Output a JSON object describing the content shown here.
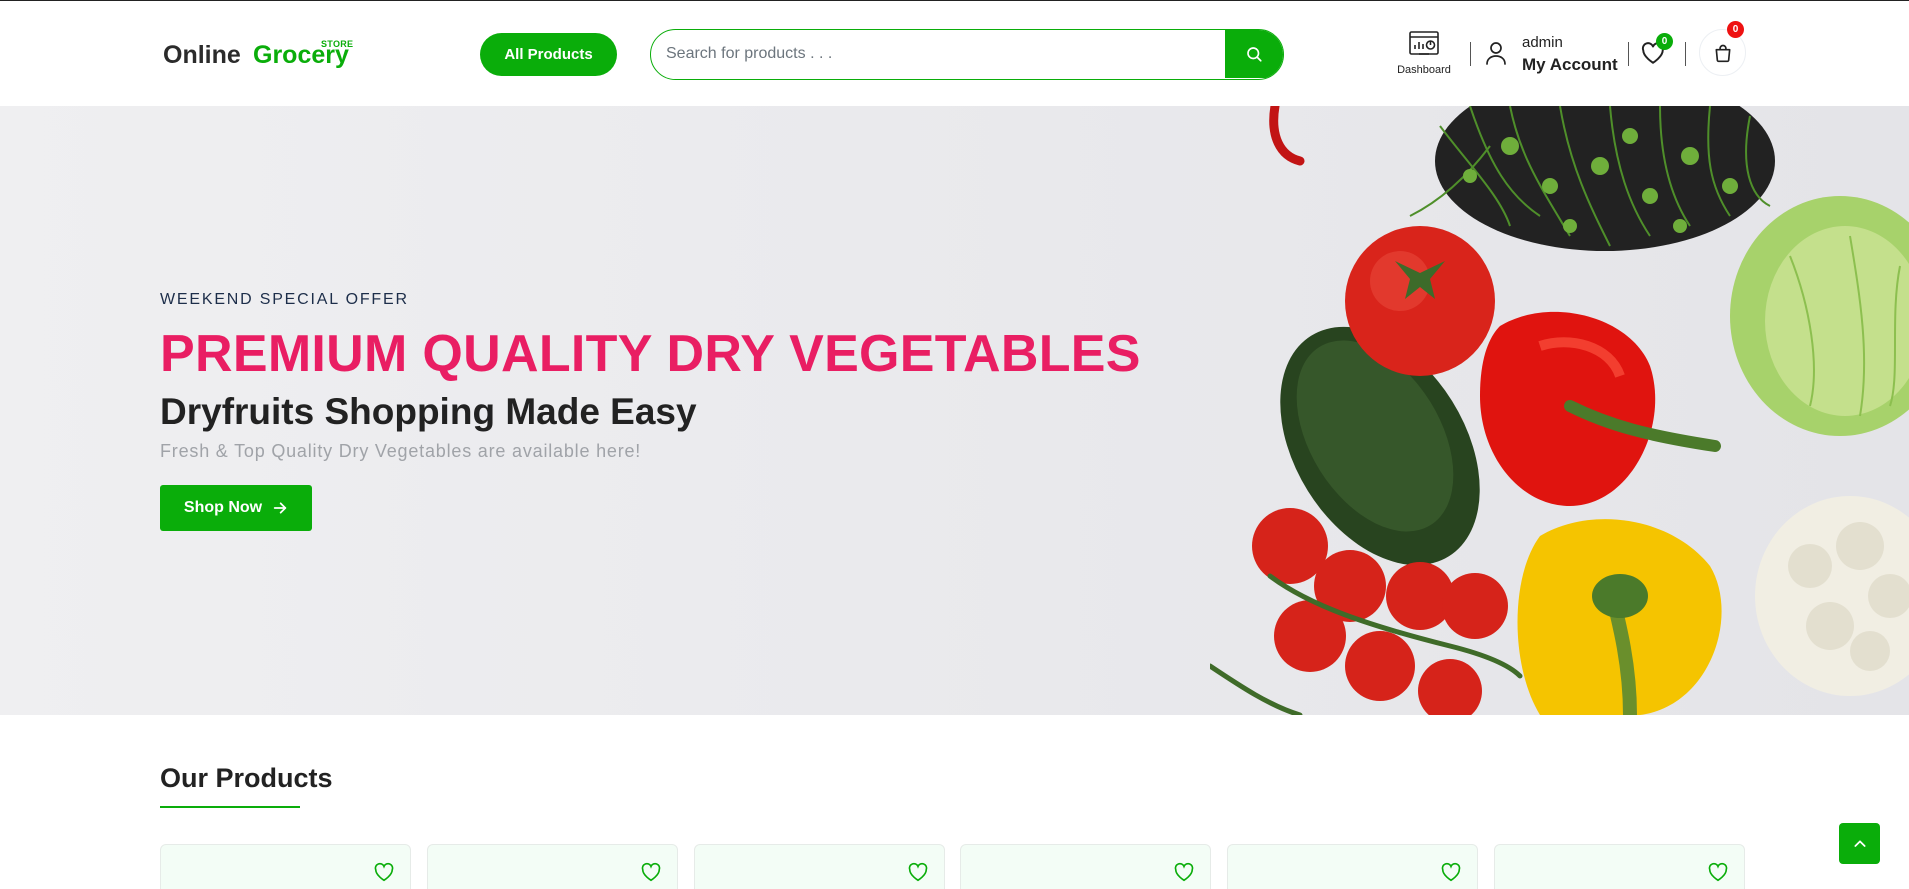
{
  "header": {
    "logo": {
      "main": "Online",
      "accent": "Grocery",
      "tag": "STORE"
    },
    "all_products_label": "All Products",
    "search": {
      "placeholder": "Search for products . . .",
      "value": ""
    },
    "dashboard_label": "Dashboard",
    "account": {
      "username": "admin",
      "label": "My Account"
    },
    "wishlist_count": "0",
    "cart_count": "0"
  },
  "hero": {
    "kicker": "WEEKEND SPECIAL OFFER",
    "title": "PREMIUM QUALITY DRY VEGETABLES",
    "subtitle": "Dryfruits Shopping Made Easy",
    "description": "Fresh & Top Quality Dry Vegetables are available here!",
    "cta_label": "Shop Now",
    "image_subject": "fresh-vegetables-photo"
  },
  "products": {
    "heading": "Our Products",
    "cards": [
      {
        "icon": "heart-icon"
      },
      {
        "icon": "heart-icon"
      },
      {
        "icon": "heart-icon"
      },
      {
        "icon": "heart-icon"
      },
      {
        "icon": "heart-icon"
      },
      {
        "icon": "heart-icon"
      }
    ]
  },
  "colors": {
    "brand_green": "#0aad0a",
    "title_pink": "#e91e63",
    "badge_red": "#ee1111"
  },
  "icons": [
    "search-icon",
    "dashboard-icon",
    "user-icon",
    "heart-icon",
    "shopping-bag-icon",
    "arrow-right-icon",
    "chevron-up-icon"
  ]
}
